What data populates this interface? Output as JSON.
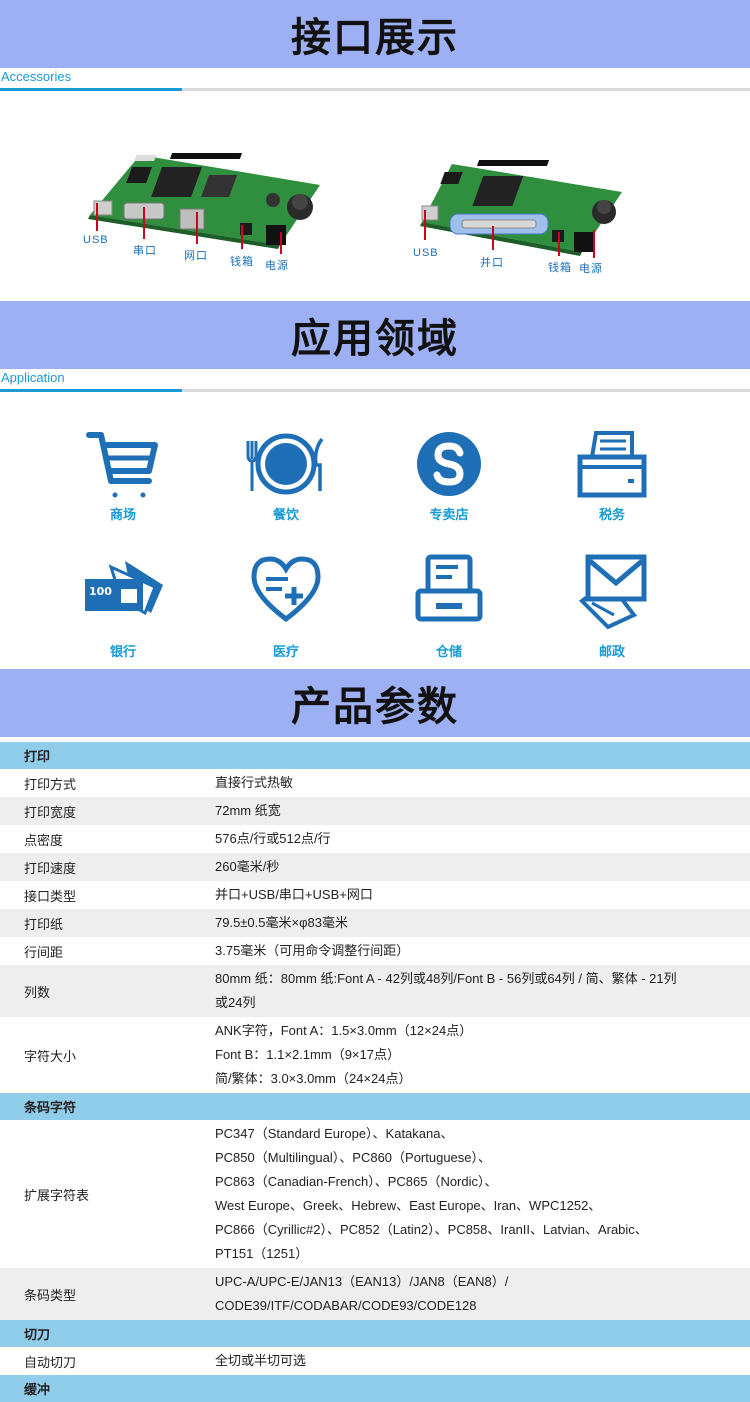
{
  "sections": {
    "interface": {
      "title": "接口展示",
      "subtitle": "Accessories"
    },
    "application": {
      "title": "应用领域",
      "subtitle": "Application"
    },
    "params": {
      "title": "产品参数"
    }
  },
  "boards": {
    "left": {
      "labels": [
        "USB",
        "串口",
        "网口",
        "钱箱",
        "电源"
      ]
    },
    "right": {
      "labels": [
        "USB",
        "并口",
        "钱箱",
        "电源"
      ]
    }
  },
  "apps": [
    {
      "icon": "shopping-cart-icon",
      "label": "商场"
    },
    {
      "icon": "dining-plate-icon",
      "label": "餐饮"
    },
    {
      "icon": "store-s-icon",
      "label": "专卖店"
    },
    {
      "icon": "printer-icon",
      "label": "税务"
    },
    {
      "icon": "banknote-icon",
      "label": "银行"
    },
    {
      "icon": "medical-heart-icon",
      "label": "医疗"
    },
    {
      "icon": "warehouse-printer-icon",
      "label": "仓储"
    },
    {
      "icon": "mail-envelope-icon",
      "label": "邮政"
    }
  ],
  "specs": {
    "print": {
      "heading": "打印",
      "rows": [
        {
          "k": "打印方式",
          "v": [
            "直接行式热敏"
          ]
        },
        {
          "k": "打印宽度",
          "v": [
            "72mm 纸宽"
          ]
        },
        {
          "k": "点密度",
          "v": [
            "576点/行或512点/行"
          ]
        },
        {
          "k": "打印速度",
          "v": [
            "260毫米/秒"
          ]
        },
        {
          "k": "接口类型",
          "v": [
            "并口+USB/串口+USB+网口"
          ]
        },
        {
          "k": "打印纸",
          "v": [
            "79.5±0.5毫米×φ83毫米"
          ]
        },
        {
          "k": "行间距",
          "v": [
            "3.75毫米（可用命令调整行间距）"
          ]
        },
        {
          "k": "列数",
          "v": [
            "80mm 纸：80mm 纸:Font A - 42列或48列/Font B - 56列或64列 / 简、繁体 - 21列",
            "或24列"
          ]
        },
        {
          "k": "字符大小",
          "v": [
            "ANK字符，Font A：1.5×3.0mm（12×24点）",
            "Font B：1.1×2.1mm（9×17点）",
            "简/繁体：3.0×3.0mm（24×24点）"
          ]
        }
      ]
    },
    "barcode": {
      "heading": "条码字符",
      "rows": [
        {
          "k": "扩展字符表",
          "v": [
            "PC347（Standard Europe）、Katakana、",
            "PC850（Multilingual）、PC860（Portuguese）、",
            "PC863（Canadian-French）、PC865（Nordic）、",
            "West Europe、Greek、Hebrew、East Europe、Iran、WPC1252、",
            "PC866（Cyrillic#2）、PC852（Latin2）、PC858、IranII、Latvian、Arabic、",
            "PT151（1251）"
          ]
        },
        {
          "k": "条码类型",
          "v": [
            "UPC-A/UPC-E/JAN13（EAN13）/JAN8（EAN8）/",
            "CODE39/ITF/CODABAR/CODE93/CODE128"
          ]
        }
      ]
    },
    "cutter": {
      "heading": "切刀",
      "rows": [
        {
          "k": "自动切刀",
          "v": [
            "全切或半切可选"
          ]
        }
      ]
    },
    "buffer": {
      "heading": "缓冲"
    }
  },
  "colors": {
    "banner": "#9eb0f4",
    "accent": "#1a9ad6",
    "icon": "#1e6fb5",
    "table_header": "#8fcdea"
  }
}
